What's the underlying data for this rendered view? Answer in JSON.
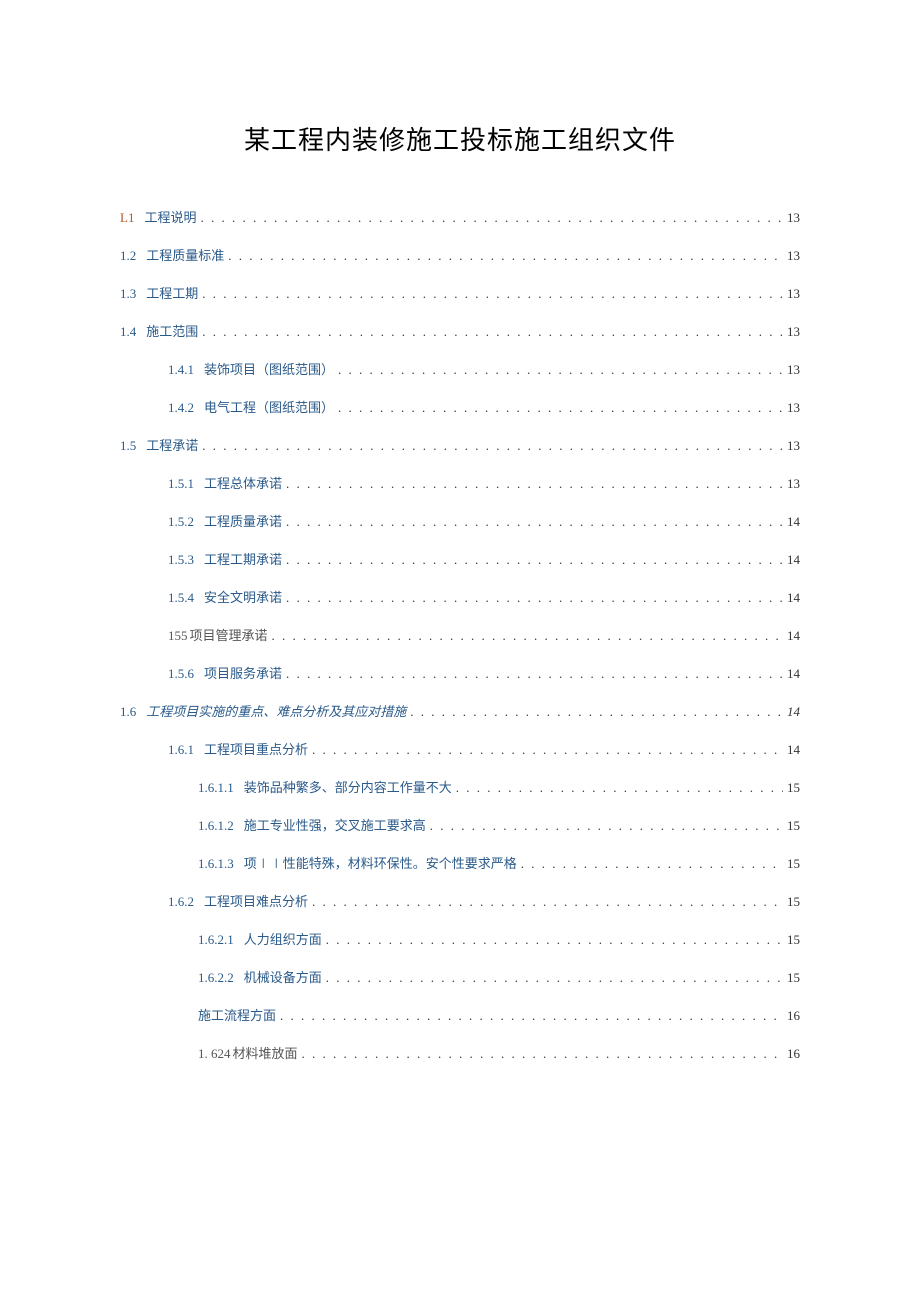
{
  "title": "某工程内装修施工投标施工组织文件",
  "toc": [
    {
      "indent": 0,
      "num": "L1",
      "numColor": "orange",
      "label": "工程说明",
      "page": "13"
    },
    {
      "indent": 0,
      "num": "1.2",
      "label": "工程质量标准",
      "page": "13"
    },
    {
      "indent": 0,
      "num": "1.3",
      "label": "工程工期",
      "page": "13"
    },
    {
      "indent": 0,
      "num": "1.4",
      "label": "施工范围",
      "page": "13"
    },
    {
      "indent": 1,
      "num": "1.4.1",
      "label": "装饰项目（图纸范围）",
      "page": "13"
    },
    {
      "indent": 1,
      "num": "1.4.2",
      "label": "电气工程（图纸范围）",
      "page": "13"
    },
    {
      "indent": 0,
      "num": "1.5",
      "label": "工程承诺",
      "page": "13"
    },
    {
      "indent": 1,
      "num": "1.5.1",
      "label": "工程总体承诺",
      "page": "13"
    },
    {
      "indent": 1,
      "num": "1.5.2",
      "label": "工程质量承诺",
      "page": "14"
    },
    {
      "indent": 1,
      "num": "1.5.3",
      "label": "工程工期承诺",
      "page": "14"
    },
    {
      "indent": 1,
      "num": "1.5.4",
      "label": "安全文明承诺",
      "page": "14"
    },
    {
      "indent": 1,
      "num": "155",
      "numColor": "gray",
      "label": "项目管理承诺",
      "labelColor": "gray",
      "noNumGap": true,
      "page": "14"
    },
    {
      "indent": 1,
      "num": "1.5.6",
      "label": "项目服务承诺",
      "page": "14"
    },
    {
      "indent": 0,
      "num": "1.6",
      "label": "工程项目实施的重点、难点分析及其应对措施",
      "page": "14",
      "pageItalic": true,
      "labelItalic": true
    },
    {
      "indent": 1,
      "num": "1.6.1",
      "label": "工程项目重点分析",
      "page": "14"
    },
    {
      "indent": 2,
      "num": "1.6.1.1",
      "label": "装饰品种繁多、部分内容工作量不大",
      "page": "15"
    },
    {
      "indent": 2,
      "num": "1.6.1.2",
      "label": "施工专业性强，交叉施工要求高",
      "page": "15"
    },
    {
      "indent": 2,
      "num": "1.6.1.3",
      "label": "项∣∣性能特殊，材料环保性。安个性要求严格",
      "page": "15"
    },
    {
      "indent": 1,
      "num": "1.6.2",
      "label": "工程项目难点分析",
      "page": "15"
    },
    {
      "indent": 2,
      "num": "1.6.2.1",
      "label": "人力组织方面",
      "page": "15"
    },
    {
      "indent": 2,
      "num": "1.6.2.2",
      "label": "机械设备方面",
      "page": "15"
    },
    {
      "indent": 2,
      "num": "",
      "label": "施工流程方面",
      "noNum": true,
      "page": "16"
    },
    {
      "indent": 2,
      "num": "1. 624",
      "numColor": "gray",
      "label": "材料堆放面",
      "labelColor": "gray",
      "noNumGap": true,
      "page": "16"
    }
  ]
}
